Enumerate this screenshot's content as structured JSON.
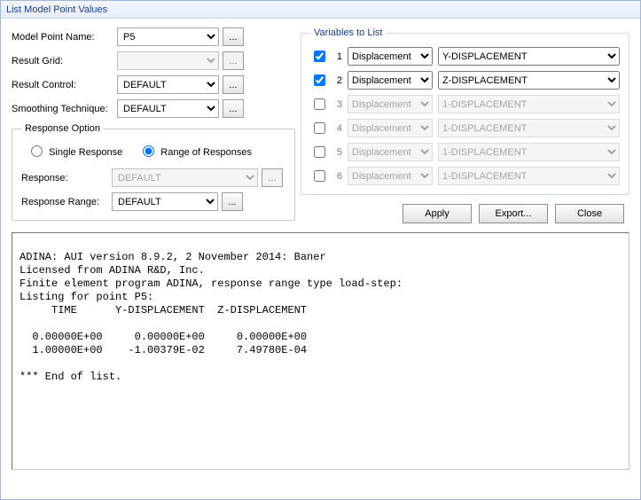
{
  "title": "List Model Point Values",
  "labels": {
    "model_point_name": "Model Point Name:",
    "result_grid": "Result Grid:",
    "result_control": "Result Control:",
    "smoothing_technique": "Smoothing Technique:",
    "response_option": "Response Option",
    "single_response": "Single Response",
    "range_of_responses": "Range of Responses",
    "response": "Response:",
    "response_range": "Response Range:",
    "variables_to_list": "Variables to List",
    "ellipsis": "..."
  },
  "values": {
    "model_point_name": "P5",
    "result_grid": "",
    "result_control": "DEFAULT",
    "smoothing_technique": "DEFAULT",
    "response": "DEFAULT",
    "response_range": "DEFAULT"
  },
  "variables": [
    {
      "n": "1",
      "checked": true,
      "enabled": true,
      "type": "Displacement",
      "var": "Y-DISPLACEMENT"
    },
    {
      "n": "2",
      "checked": true,
      "enabled": true,
      "type": "Displacement",
      "var": "Z-DISPLACEMENT"
    },
    {
      "n": "3",
      "checked": false,
      "enabled": false,
      "type": "Displacement",
      "var": "1-DISPLACEMENT"
    },
    {
      "n": "4",
      "checked": false,
      "enabled": false,
      "type": "Displacement",
      "var": "1-DISPLACEMENT"
    },
    {
      "n": "5",
      "checked": false,
      "enabled": false,
      "type": "Displacement",
      "var": "1-DISPLACEMENT"
    },
    {
      "n": "6",
      "checked": false,
      "enabled": false,
      "type": "Displacement",
      "var": "1-DISPLACEMENT"
    }
  ],
  "buttons": {
    "apply": "Apply",
    "export": "Export...",
    "close": "Close"
  },
  "output": "ADINA: AUI version 8.9.2, 2 November 2014: Baner\nLicensed from ADINA R&D, Inc.\nFinite element program ADINA, response range type load-step:\nListing for point P5:\n     TIME      Y-DISPLACEMENT  Z-DISPLACEMENT\n\n  0.00000E+00     0.00000E+00     0.00000E+00\n  1.00000E+00    -1.00379E-02     7.49780E-04\n\n*** End of list.\n"
}
